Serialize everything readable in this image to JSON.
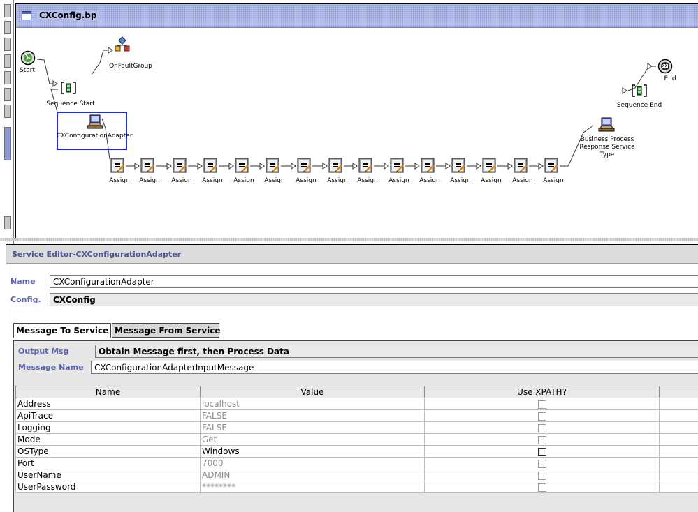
{
  "window": {
    "title": "CXConfig.bp"
  },
  "flow": {
    "nodes": {
      "start": "Start",
      "on_fault_group": "OnFaultGroup",
      "sequence_start": "Sequence Start",
      "adapter": "CXConfigurationAdapter",
      "assign": "Assign",
      "response_service": "Business Process Response Service Type",
      "sequence_end": "Sequence End",
      "end": "End"
    },
    "assign_count": 15,
    "selected_node": "CXConfigurationAdapter"
  },
  "editor": {
    "header": "Service Editor-CXConfigurationAdapter",
    "name_label": "Name",
    "name_value": "CXConfigurationAdapter",
    "config_label": "Config.",
    "config_value": "CXConfig",
    "tabs": [
      "Message To Service",
      "Message From Service"
    ],
    "active_tab": "Message To Service",
    "output_msg_label": "Output Msg",
    "output_msg_value": "Obtain Message first, then Process Data",
    "message_name_label": "Message Name",
    "message_name_value": "CXConfigurationAdapterInputMessage",
    "table": {
      "columns": [
        "Name",
        "Value",
        "Use XPATH?"
      ],
      "rows": [
        {
          "name": "Address",
          "value": "localhost",
          "xpath": false
        },
        {
          "name": "ApiTrace",
          "value": "FALSE",
          "xpath": false
        },
        {
          "name": "Logging",
          "value": "FALSE",
          "xpath": false
        },
        {
          "name": "Mode",
          "value": "Get",
          "xpath": false
        },
        {
          "name": "OSType",
          "value": "Windows",
          "xpath": false
        },
        {
          "name": "Port",
          "value": "7000",
          "xpath": false
        },
        {
          "name": "UserName",
          "value": "ADMIN",
          "xpath": false
        },
        {
          "name": "UserPassword",
          "value": "********",
          "xpath": false
        }
      ]
    }
  },
  "colors": {
    "title_bar": "#b6bfe9",
    "selection": "#1e2be6",
    "field_label": "#5b66ae",
    "editor_header_text": "#4d5491"
  }
}
